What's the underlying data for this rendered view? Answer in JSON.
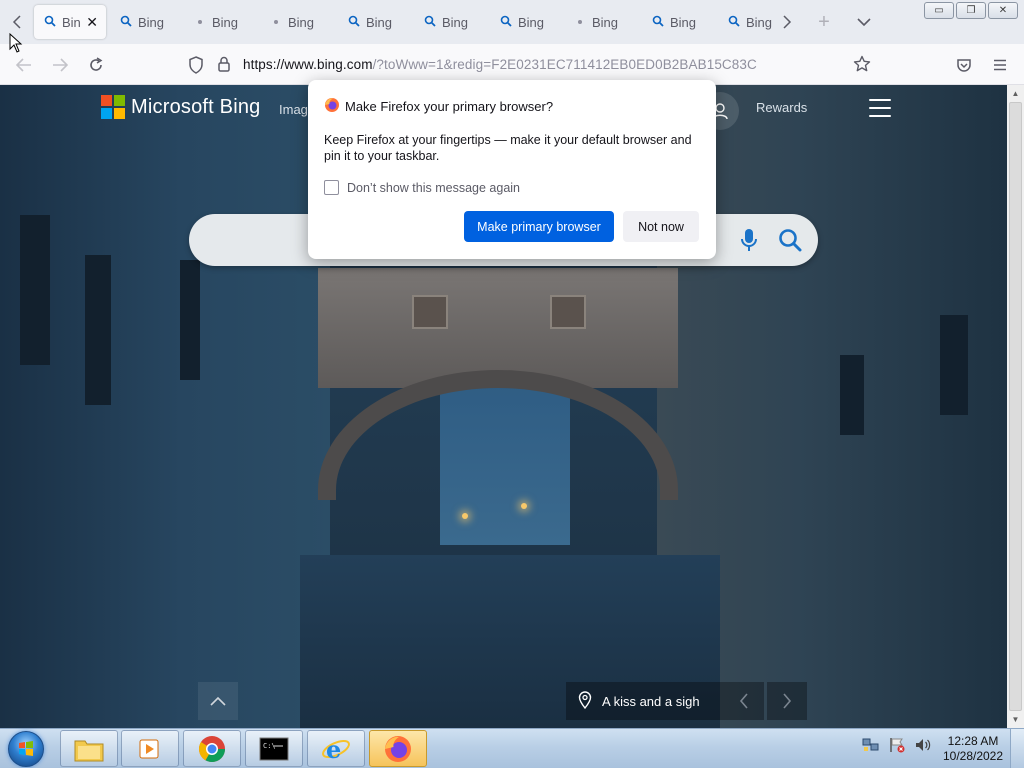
{
  "browser": {
    "tabs": [
      {
        "label": "Bing",
        "active": true,
        "icon": "search-icon"
      },
      {
        "label": "Bing",
        "icon": "search-icon"
      },
      {
        "label": "Bing",
        "icon": "dot-icon"
      },
      {
        "label": "Bing",
        "icon": "dot-icon"
      },
      {
        "label": "Bing",
        "icon": "search-icon"
      },
      {
        "label": "Bing",
        "icon": "search-icon"
      },
      {
        "label": "Bing",
        "icon": "search-icon"
      },
      {
        "label": "Bing",
        "icon": "dot-icon"
      },
      {
        "label": "Bing",
        "icon": "search-icon"
      },
      {
        "label": "Bing",
        "icon": "search-icon"
      }
    ],
    "url_host": "https://www.bing.com",
    "url_path": "/?toWww=1&redig=F2E0231EC711412EB0ED0B2BAB15C83C"
  },
  "bing": {
    "brand": "Microsoft Bing",
    "nav_images": "Imag",
    "rewards": "Rewards",
    "location_caption": "A kiss and a sigh"
  },
  "dialog": {
    "title": "Make Firefox your primary browser?",
    "body": "Keep Firefox at your fingertips — make it your default browser and pin it to your taskbar.",
    "checkbox_label": "Don’t show this message again",
    "primary_button": "Make primary browser",
    "secondary_button": "Not now"
  },
  "taskbar": {
    "time": "12:28 AM",
    "date": "10/28/2022"
  },
  "colors": {
    "accent": "#0061e0",
    "tab_bar": "#e8ebf1"
  }
}
